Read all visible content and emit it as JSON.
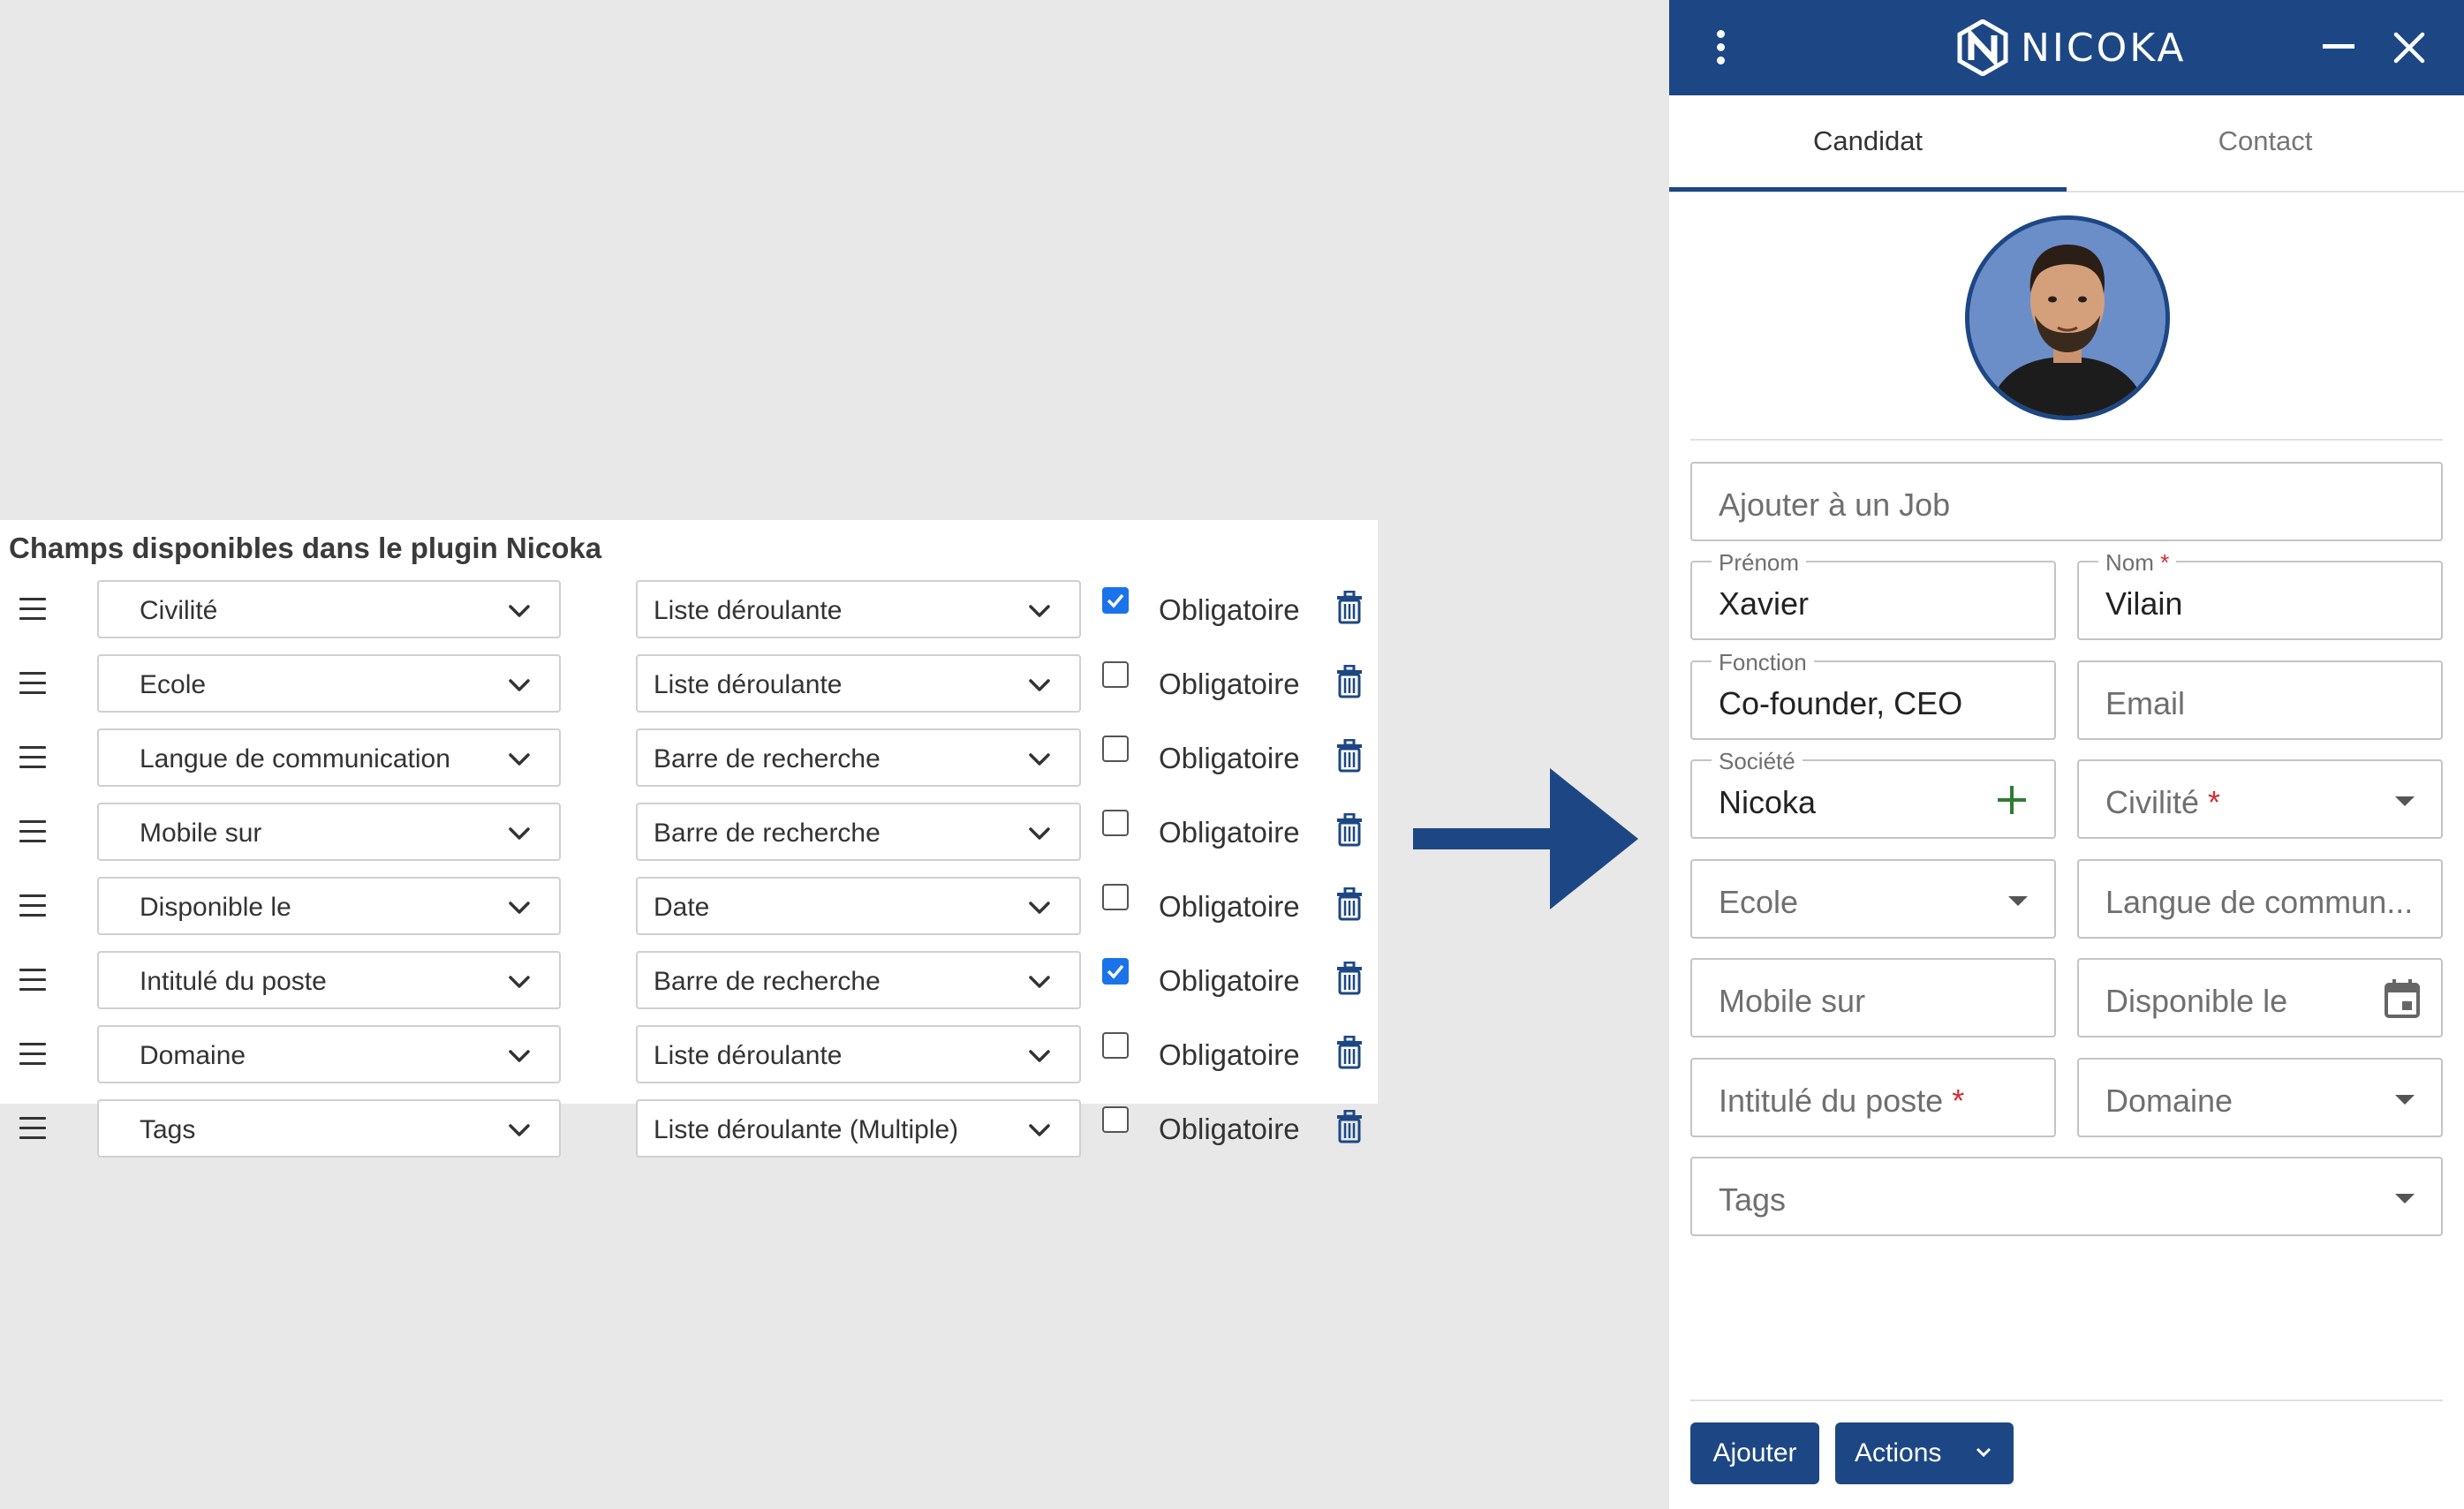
{
  "config": {
    "title": "Champs disponibles dans le plugin Nicoka",
    "rows": [
      {
        "field": "Civilité",
        "type": "Liste déroulante",
        "required": true,
        "required_label": "Obligatoire"
      },
      {
        "field": "Ecole",
        "type": "Liste déroulante",
        "required": false,
        "required_label": "Obligatoire"
      },
      {
        "field": "Langue de communication",
        "type": "Barre de recherche",
        "required": false,
        "required_label": "Obligatoire"
      },
      {
        "field": "Mobile sur",
        "type": "Barre de recherche",
        "required": false,
        "required_label": "Obligatoire"
      },
      {
        "field": "Disponible le",
        "type": "Date",
        "required": false,
        "required_label": "Obligatoire"
      },
      {
        "field": "Intitulé du poste",
        "type": "Barre de recherche",
        "required": true,
        "required_label": "Obligatoire"
      },
      {
        "field": "Domaine",
        "type": "Liste déroulante",
        "required": false,
        "required_label": "Obligatoire"
      },
      {
        "field": "Tags",
        "type": "Liste déroulante (Multiple)",
        "required": false,
        "required_label": "Obligatoire"
      }
    ]
  },
  "plugin": {
    "brand": "NICOKA",
    "tabs": {
      "active": "Candidat",
      "other": "Contact"
    },
    "job": {
      "placeholder": "Ajouter à un Job"
    },
    "prenom": {
      "label": "Prénom",
      "value": "Xavier"
    },
    "nom": {
      "label": "Nom",
      "value": "Vilain",
      "required_mark": "*"
    },
    "fonction": {
      "label": "Fonction",
      "value": "Co-founder, CEO"
    },
    "email": {
      "placeholder": "Email"
    },
    "societe": {
      "label": "Société",
      "value": "Nicoka"
    },
    "civilite": {
      "placeholder": "Civilité",
      "required_mark": "*"
    },
    "ecole": {
      "placeholder": "Ecole"
    },
    "langue": {
      "placeholder": "Langue de commun..."
    },
    "mobile": {
      "placeholder": "Mobile sur"
    },
    "disponible": {
      "placeholder": "Disponible le"
    },
    "intitule": {
      "placeholder": "Intitulé du poste",
      "required_mark": "*"
    },
    "domaine": {
      "placeholder": "Domaine"
    },
    "tags": {
      "placeholder": "Tags"
    },
    "buttons": {
      "add": "Ajouter",
      "actions": "Actions"
    }
  },
  "colors": {
    "brand": "#1d4784",
    "checkbox": "#1a73e8",
    "required": "#d32f2f",
    "add_icon": "#2e7d32"
  },
  "icons": [
    "drag-handle-icon",
    "chevron-down-icon",
    "trash-icon",
    "kebab-menu-icon",
    "minimize-icon",
    "close-icon",
    "plus-icon",
    "calendar-icon",
    "arrow-right-icon"
  ]
}
